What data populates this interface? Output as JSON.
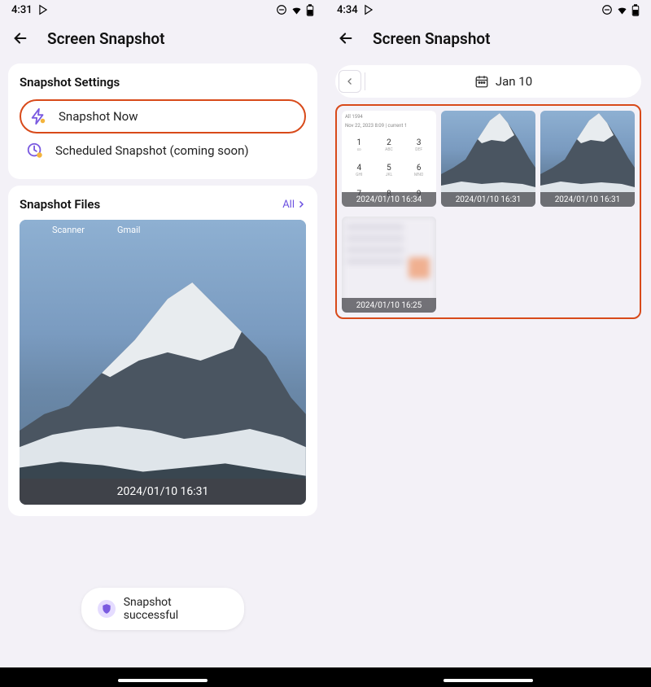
{
  "left": {
    "status_time": "4:31",
    "title": "Screen Snapshot",
    "settings_header": "Snapshot Settings",
    "snapshot_now_label": "Snapshot Now",
    "scheduled_label": "Scheduled Snapshot (coming soon)",
    "files_header": "Snapshot Files",
    "all_label": "All",
    "thumb_app1": "Scanner",
    "thumb_app2": "Gmail",
    "thumb_timestamp": "2024/01/10 16:31",
    "toast": "Snapshot successful"
  },
  "right": {
    "status_time": "4:34",
    "title": "Screen Snapshot",
    "date_label": "Jan 10",
    "dialer_date": "Nov 22, 2023 8:09 | current 1",
    "thumbs": [
      {
        "ts": "2024/01/10 16:34"
      },
      {
        "ts": "2024/01/10 16:31"
      },
      {
        "ts": "2024/01/10 16:31"
      },
      {
        "ts": "2024/01/10 16:25"
      }
    ]
  }
}
